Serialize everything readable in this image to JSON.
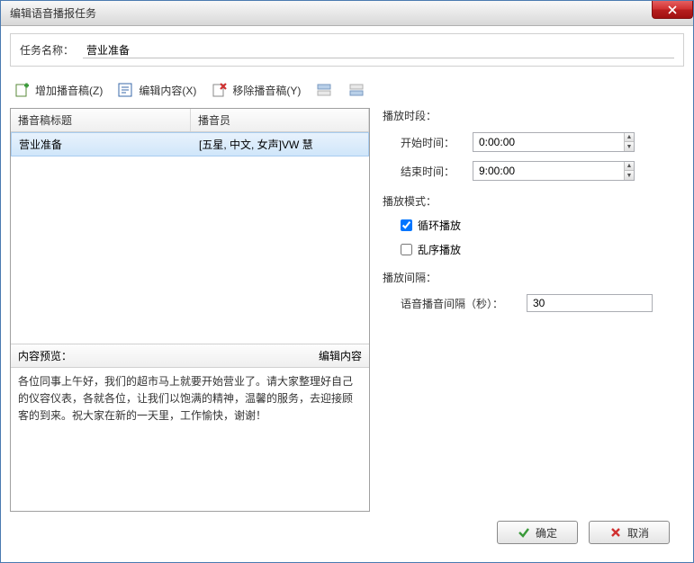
{
  "window": {
    "title": "编辑语音播报任务"
  },
  "task": {
    "name_label": "任务名称：",
    "name_value": "营业准备"
  },
  "toolbar": {
    "add": "增加播音稿(Z)",
    "edit": "编辑内容(X)",
    "remove": "移除播音稿(Y)"
  },
  "list": {
    "col_title": "播音稿标题",
    "col_voice": "播音员",
    "rows": [
      {
        "title": "营业准备",
        "voice": "[五星, 中文, 女声]VW 慧"
      }
    ]
  },
  "preview": {
    "label": "内容预览：",
    "edit_label": "编辑内容",
    "text": "各位同事上午好，我们的超市马上就要开始营业了。请大家整理好自己的仪容仪表，各就各位，让我们以饱满的精神，温馨的服务，去迎接顾客的到来。祝大家在新的一天里，工作愉快，谢谢！"
  },
  "period": {
    "title": "播放时段：",
    "start_label": "开始时间：",
    "start_value": "0:00:00",
    "end_label": "结束时间：",
    "end_value": "9:00:00"
  },
  "mode": {
    "title": "播放模式：",
    "loop": "循环播放",
    "shuffle": "乱序播放",
    "loop_checked": true,
    "shuffle_checked": false
  },
  "interval": {
    "title": "播放间隔：",
    "label": "语音播音间隔（秒）：",
    "value": "30"
  },
  "buttons": {
    "ok": "确定",
    "cancel": "取消"
  }
}
